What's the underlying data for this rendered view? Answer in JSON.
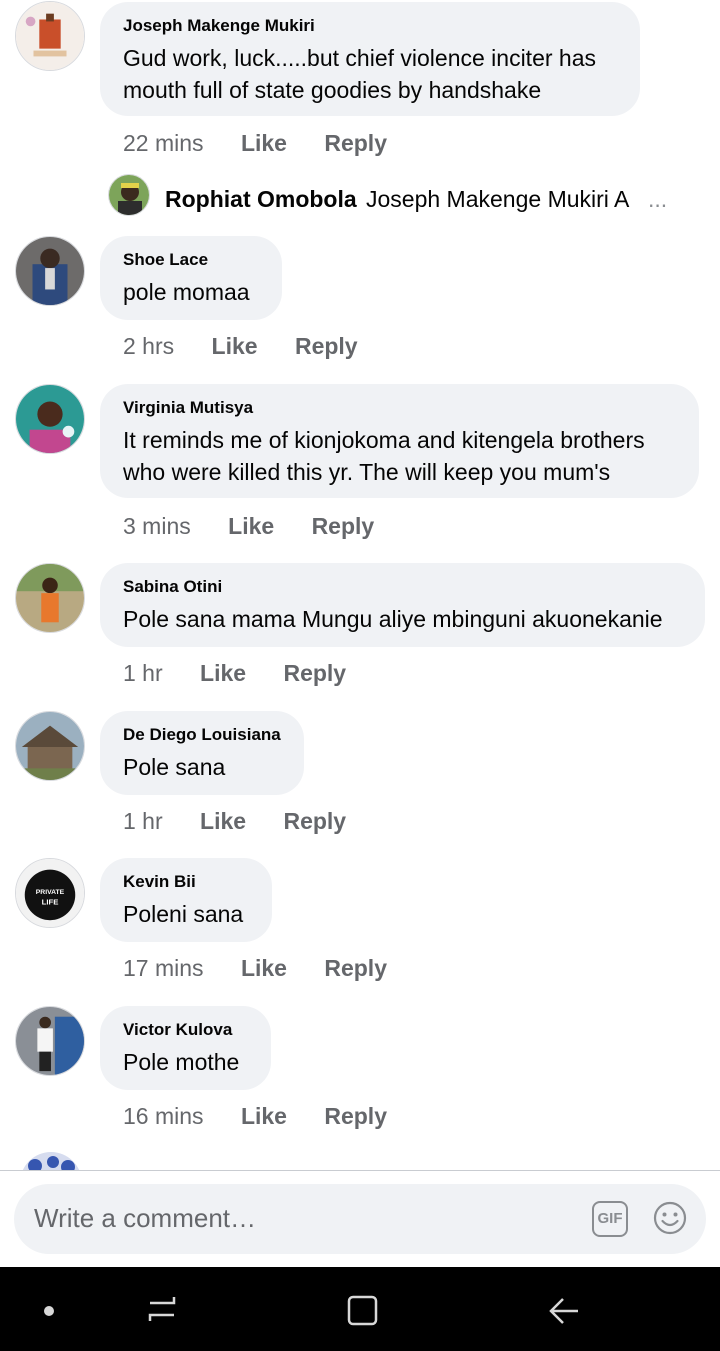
{
  "comments": [
    {
      "author": "Joseph Makenge Mukiri",
      "lines": [
        "Gud work, luck.....but chief violence inciter has",
        "mouth full of state goodies by handshake"
      ],
      "time": "22 mins",
      "like": "Like",
      "reply": "Reply",
      "reply_preview": {
        "author": "Rophiat Omobola",
        "text": "Joseph Makenge Mukiri A",
        "ellipsis": "..."
      }
    },
    {
      "author": "Shoe Lace",
      "lines": [
        "pole momaa"
      ],
      "time": "2 hrs",
      "like": "Like",
      "reply": "Reply"
    },
    {
      "author": "Virginia Mutisya",
      "lines": [
        "It reminds me of kionjokoma and kitengela brothers",
        "who were killed this yr. The will keep you mum's"
      ],
      "time": "3 mins",
      "like": "Like",
      "reply": "Reply"
    },
    {
      "author": "Sabina Otini",
      "lines": [
        "Pole sana mama Mungu aliye mbinguni akuonekanie"
      ],
      "time": "1 hr",
      "like": "Like",
      "reply": "Reply"
    },
    {
      "author": "De Diego Louisiana",
      "lines": [
        "Pole sana"
      ],
      "time": "1 hr",
      "like": "Like",
      "reply": "Reply"
    },
    {
      "author": "Kevin Bii",
      "lines": [
        "Poleni sana"
      ],
      "time": "17 mins",
      "like": "Like",
      "reply": "Reply",
      "avatar_text": [
        "PRIVATE",
        "LIFE"
      ]
    },
    {
      "author": "Victor Kulova",
      "lines": [
        "Pole mothe"
      ],
      "time": "16 mins",
      "like": "Like",
      "reply": "Reply"
    }
  ],
  "composer": {
    "placeholder": "Write a comment…",
    "gif_label": "GIF",
    "emoji_icon": "smiley-icon"
  },
  "navbar": {
    "icons": [
      "dot-icon",
      "recent-apps-icon",
      "home-icon",
      "back-icon"
    ]
  },
  "colors": {
    "bubble": "#f0f2f5",
    "text": "#050505",
    "meta": "#65676b",
    "navbar": "#000000"
  }
}
